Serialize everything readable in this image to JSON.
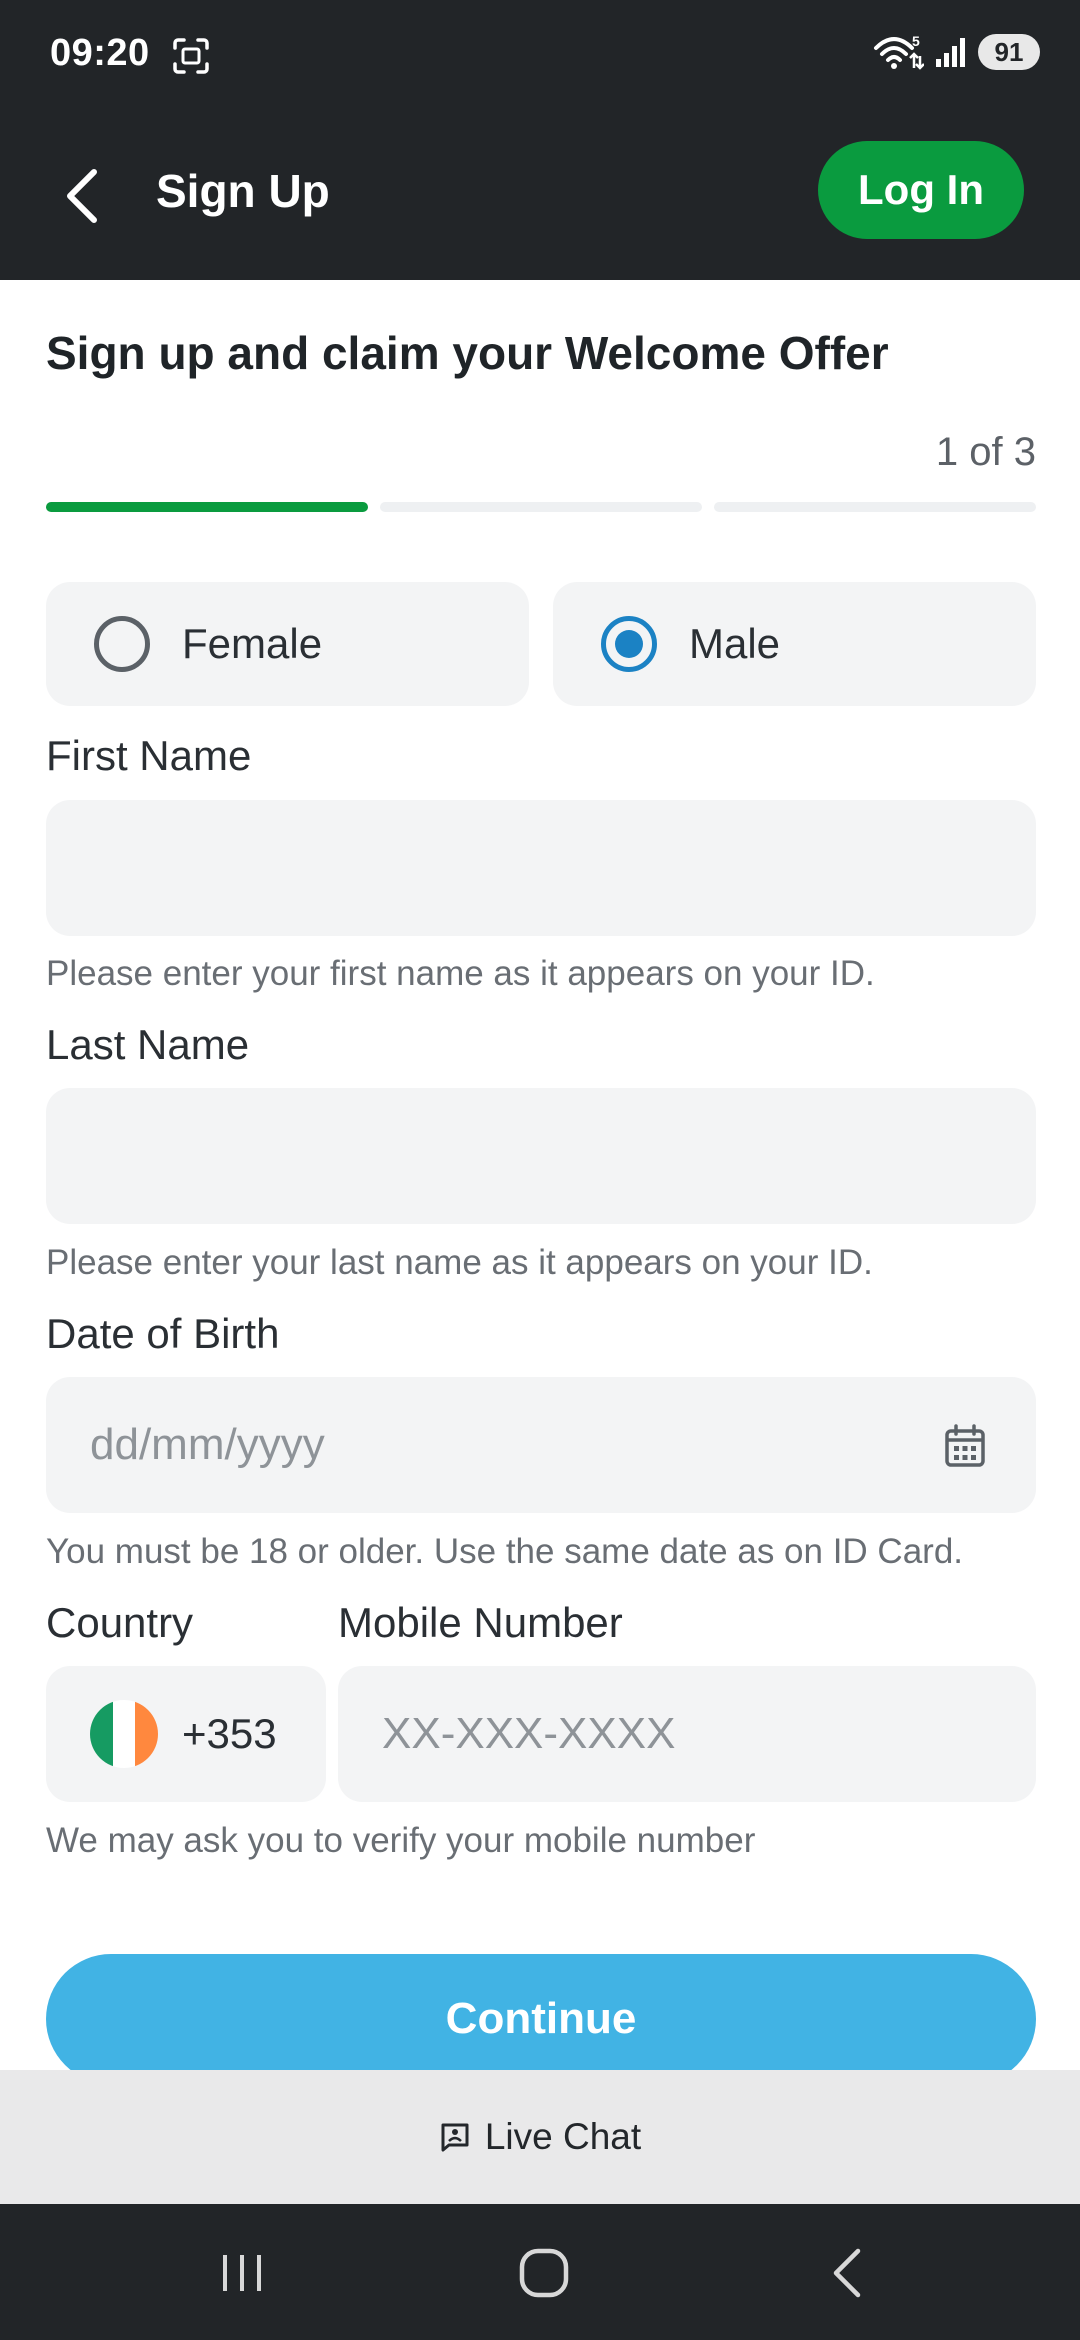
{
  "status_bar": {
    "time": "09:20",
    "battery": "91",
    "icons": [
      "screenshot-icon",
      "wifi-icon",
      "signal-icon",
      "battery-icon"
    ]
  },
  "header": {
    "title": "Sign Up",
    "login_label": "Log In",
    "back_icon": "chevron-left-icon",
    "accent_color": "#0a9b3f"
  },
  "form": {
    "heading": "Sign up and claim your Welcome Offer",
    "step_counter": "1 of 3",
    "progress": {
      "current_step": 1,
      "total_steps": 3
    },
    "gender": {
      "options": [
        "Female",
        "Male"
      ],
      "selected": "Male"
    },
    "first_name": {
      "label": "First Name",
      "value": "",
      "placeholder": "",
      "hint": "Please enter your first name as it appears on your ID."
    },
    "last_name": {
      "label": "Last Name",
      "value": "",
      "placeholder": "",
      "hint": "Please enter your last name as it appears on your ID."
    },
    "dob": {
      "label": "Date of Birth",
      "value": "",
      "placeholder": "dd/mm/yyyy",
      "hint": "You must be 18 or older. Use the same date as on ID Card.",
      "icon": "calendar-icon"
    },
    "country": {
      "label": "Country",
      "dial_code": "+353",
      "flag_icon": "ireland-flag-icon"
    },
    "mobile": {
      "label": "Mobile Number",
      "value": "",
      "placeholder": "XX-XXX-XXXX",
      "hint": "We may ask you to verify your mobile number"
    },
    "continue_label": "Continue",
    "continue_color": "#41b3e4"
  },
  "live_chat": {
    "label": "Live Chat",
    "icon": "chat-icon"
  },
  "nav_bar": {
    "icons": [
      "recent-apps-icon",
      "home-icon",
      "back-icon"
    ]
  }
}
